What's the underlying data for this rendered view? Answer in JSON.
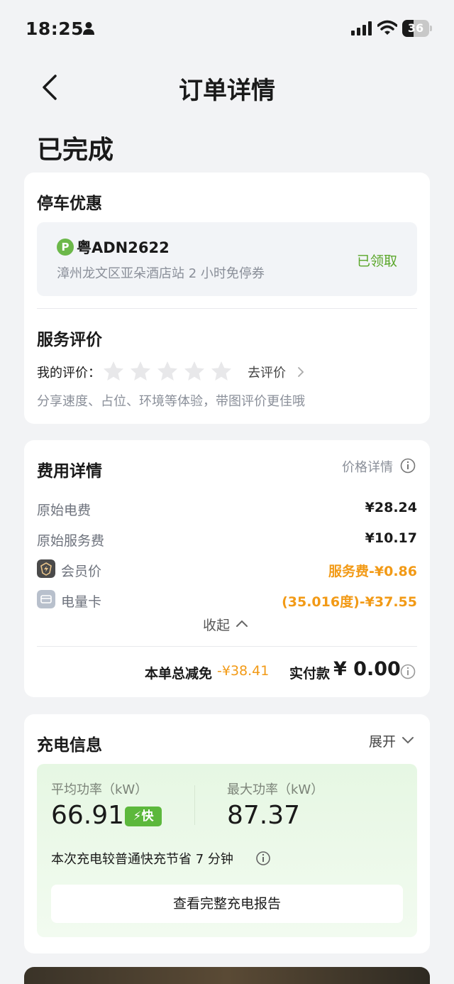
{
  "status_bar": {
    "time": "18:25",
    "battery": "36"
  },
  "nav": {
    "title": "订单详情"
  },
  "order": {
    "status": "已完成"
  },
  "parking": {
    "title": "停车优惠",
    "plate": "粤ADN2622",
    "description": "漳州龙文区亚朵酒店站 2 小时免停券",
    "status": "已领取",
    "badge": "P"
  },
  "review": {
    "title": "服务评价",
    "my_rating_label": "我的评价：",
    "stars": 0,
    "go_rate": "去评价",
    "hint": "分享速度、占位、环境等体验，带图评价更佳哦"
  },
  "fees": {
    "title": "费用详情",
    "price_detail": "价格详情",
    "rows": [
      {
        "label": "原始电费",
        "value": "¥28.24"
      },
      {
        "label": "原始服务费",
        "value": "¥10.17"
      },
      {
        "label": "会员价",
        "value": "服务费-¥0.86"
      },
      {
        "label": "电量卡",
        "value": "(35.016度)-¥37.55"
      }
    ],
    "collapse": "收起",
    "total_discount_label": "本单总减免",
    "total_discount": "-¥38.41",
    "paid_label": "实付款",
    "paid_value": "¥ 0.00"
  },
  "charging": {
    "title": "充电信息",
    "expand": "展开",
    "avg_power_label": "平均功率（kW）",
    "avg_power": "66.91",
    "fast_badge": "⚡快",
    "max_power_label": "最大功率（kW）",
    "max_power": "87.37",
    "saving": "本次充电较普通快充节省 7 分钟",
    "report_button": "查看完整充电报告"
  },
  "colors": {
    "accent_green": "#5aa629",
    "orange": "#f29a16",
    "fast_green": "#5cb83c"
  }
}
